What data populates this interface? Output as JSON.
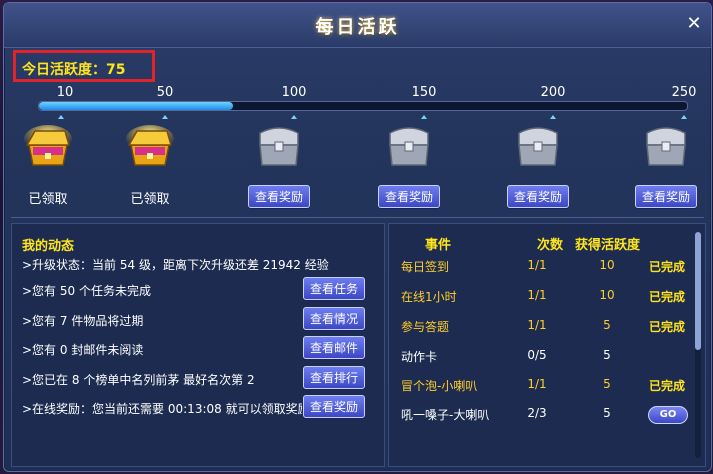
{
  "window": {
    "title": "每日活跃",
    "close_label": "✕"
  },
  "activity": {
    "label": "今日活跃度：75",
    "value": 75,
    "max": 250
  },
  "progress": {
    "fill_fraction": 0.3,
    "ticks": [
      "10",
      "50",
      "100",
      "150",
      "200",
      "250"
    ]
  },
  "rewards": [
    {
      "threshold": "10",
      "state": "claimed",
      "label": "已领取"
    },
    {
      "threshold": "50",
      "state": "claimed",
      "label": "已领取"
    },
    {
      "threshold": "100",
      "state": "locked",
      "label": "查看奖励"
    },
    {
      "threshold": "150",
      "state": "locked",
      "label": "查看奖励"
    },
    {
      "threshold": "200",
      "state": "locked",
      "label": "查看奖励"
    },
    {
      "threshold": "250",
      "state": "locked",
      "label": "查看奖励"
    }
  ],
  "dynamics": {
    "title": "我的动态",
    "lines": [
      {
        "text": ">升级状态：当前  54  级，距离下次升级还差  21942  经验",
        "button": ""
      },
      {
        "text": ">您有  50  个任务未完成",
        "button": "查看任务"
      },
      {
        "text": ">您有  7  件物品将过期",
        "button": "查看情况"
      },
      {
        "text": ">您有  0  封邮件未阅读",
        "button": "查看邮件"
      },
      {
        "text": ">您已在  8  个榜单中名列前茅    最好名次第  2",
        "button": "查看排行"
      },
      {
        "text": ">在线奖励：您当前还需要 00:13:08 就可以领取奖励",
        "button": "查看奖励"
      }
    ]
  },
  "events": {
    "headers": {
      "name": "事件",
      "count": "次数",
      "points": "获得活跃度"
    },
    "rows": [
      {
        "name": "每日签到",
        "count": "1/1",
        "points": "10",
        "status": "已完成",
        "done": true
      },
      {
        "name": "在线1小时",
        "count": "1/1",
        "points": "10",
        "status": "已完成",
        "done": true
      },
      {
        "name": "参与答题",
        "count": "1/1",
        "points": "5",
        "status": "已完成",
        "done": true
      },
      {
        "name": "动作卡",
        "count": "0/5",
        "points": "5",
        "status": "",
        "done": false
      },
      {
        "name": "冒个泡-小喇叭",
        "count": "1/1",
        "points": "5",
        "status": "已完成",
        "done": true
      },
      {
        "name": "吼一嗓子-大喇叭",
        "count": "2/3",
        "points": "5",
        "status": "GO",
        "done": false
      }
    ],
    "scroll_fraction": 0.52
  },
  "colors": {
    "accent_yellow": "#ffe51c",
    "highlight_red": "#e0242c",
    "progress_blue": "#1d8ee8"
  }
}
